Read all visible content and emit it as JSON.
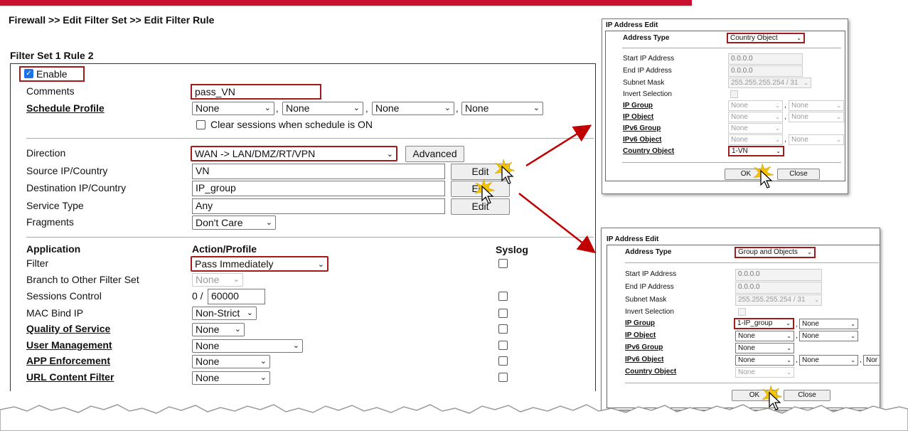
{
  "breadcrumb": "Firewall >> Edit Filter Set >> Edit Filter Rule",
  "section_title": "Filter Set 1 Rule 2",
  "enable": {
    "label": "Enable",
    "checked": true
  },
  "comments": {
    "label": "Comments",
    "value": "pass_VN"
  },
  "schedule": {
    "label": "Schedule Profile",
    "values": [
      "None",
      "None",
      "None",
      "None"
    ],
    "sep": ",",
    "clear_label": "Clear sessions when schedule is ON"
  },
  "direction": {
    "label": "Direction",
    "value": "WAN -> LAN/DMZ/RT/VPN",
    "advanced": "Advanced"
  },
  "source": {
    "label": "Source IP/Country",
    "value": "VN",
    "edit": "Edit"
  },
  "destination": {
    "label": "Destination IP/Country",
    "value": "IP_group",
    "edit": "Edit"
  },
  "service": {
    "label": "Service Type",
    "value": "Any",
    "edit": "Edit"
  },
  "fragments": {
    "label": "Fragments",
    "value": "Don't Care"
  },
  "headers": {
    "application": "Application",
    "action": "Action/Profile",
    "syslog": "Syslog"
  },
  "filter": {
    "label": "Filter",
    "value": "Pass Immediately"
  },
  "branch": {
    "label": "Branch to Other Filter Set",
    "value": "None"
  },
  "sessions": {
    "label": "Sessions Control",
    "prefix": "0 /",
    "value": "60000"
  },
  "macbind": {
    "label": "MAC Bind IP",
    "value": "Non-Strict"
  },
  "qos": {
    "label": "Quality of Service",
    "value": "None"
  },
  "user_mgmt": {
    "label": "User Management",
    "value": "None"
  },
  "app_enf": {
    "label": "APP Enforcement",
    "value": "None"
  },
  "url_filter": {
    "label": "URL Content Filter",
    "value": "None"
  },
  "popup1": {
    "title": "IP Address Edit",
    "address_type_label": "Address Type",
    "address_type_value": "Country Object",
    "start_label": "Start IP Address",
    "start_value": "0.0.0.0",
    "end_label": "End IP Address",
    "end_value": "0.0.0.0",
    "mask_label": "Subnet Mask",
    "mask_value": "255.255.255.254 / 31",
    "invert_label": "Invert Selection",
    "ipgroup_label": "IP Group",
    "ipgroup_values": [
      "None",
      "None"
    ],
    "ipobject_label": "IP Object",
    "ipobject_values": [
      "None",
      "None"
    ],
    "ipv6group_label": "IPv6 Group",
    "ipv6group_values": [
      "None"
    ],
    "ipv6object_label": "IPv6 Object",
    "ipv6object_values": [
      "None",
      "None"
    ],
    "country_label": "Country Object",
    "country_value": "1-VN",
    "ok": "OK",
    "close": "Close"
  },
  "popup2": {
    "title": "IP Address Edit",
    "address_type_label": "Address Type",
    "address_type_value": "Group and Objects",
    "start_label": "Start IP Address",
    "start_value": "0.0.0.0",
    "end_label": "End IP Address",
    "end_value": "0.0.0.0",
    "mask_label": "Subnet Mask",
    "mask_value": "255.255.255.254 / 31",
    "invert_label": "Invert Selection",
    "ipgroup_label": "IP Group",
    "ipgroup_values": [
      "1-IP_group",
      "None"
    ],
    "ipobject_label": "IP Object",
    "ipobject_values": [
      "None",
      "None"
    ],
    "ipv6group_label": "IPv6 Group",
    "ipv6group_values": [
      "None"
    ],
    "ipv6object_label": "IPv6 Object",
    "ipv6object_values": [
      "None",
      "None",
      "Nor"
    ],
    "country_label": "Country Object",
    "country_value": "None",
    "ok": "OK",
    "close": "Close"
  },
  "colors": {
    "accent": "#c8102e",
    "highlight": "#a31a1a",
    "arrow": "#c00000"
  }
}
